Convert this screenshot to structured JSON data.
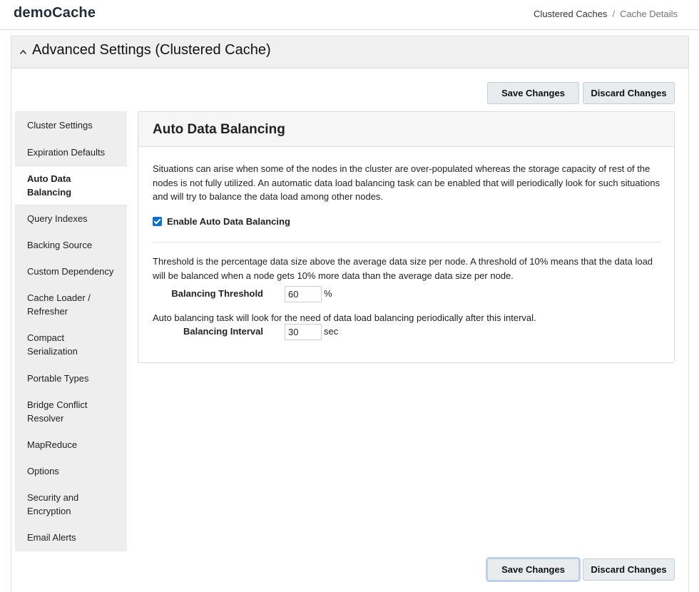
{
  "app": {
    "title": "demoCache"
  },
  "breadcrumb": {
    "items": [
      "Clustered Caches",
      "Cache Details"
    ],
    "separator": "/"
  },
  "panel": {
    "title": "Advanced Settings (Clustered Cache)",
    "collapse_icon": "chevron-up-icon"
  },
  "actions": {
    "save_label": "Save Changes",
    "discard_label": "Discard Changes"
  },
  "sidebar": {
    "active_index": 2,
    "items": [
      {
        "label": "Cluster Settings"
      },
      {
        "label": "Expiration Defaults"
      },
      {
        "label": "Auto Data Balancing"
      },
      {
        "label": "Query Indexes"
      },
      {
        "label": "Backing Source"
      },
      {
        "label": "Custom Dependency"
      },
      {
        "label": "Cache Loader / Refresher"
      },
      {
        "label": "Compact Serialization"
      },
      {
        "label": "Portable Types"
      },
      {
        "label": "Bridge Conflict Resolver"
      },
      {
        "label": "MapReduce"
      },
      {
        "label": "Options"
      },
      {
        "label": "Security and Encryption"
      },
      {
        "label": "Email Alerts"
      }
    ]
  },
  "content": {
    "title": "Auto Data Balancing",
    "description": "Situations can arise when some of the nodes in the cluster are over-populated whereas the storage capacity of rest of the nodes is not fully utilized. An automatic data load balancing task can be enabled that will periodically look for such situations and will try to balance the data load among other nodes.",
    "enable_label": "Enable Auto Data Balancing",
    "enable_checked": true,
    "threshold_description": "Threshold is the percentage data size above the average data size per node. A threshold of 10% means that the data load will be balanced when a node gets 10% more data than the average data size per node.",
    "threshold_label": "Balancing Threshold",
    "threshold_value": "60",
    "threshold_unit": "%",
    "interval_description": "Auto balancing task will look for the need of data load balancing periodically after this interval.",
    "interval_label": "Balancing Interval",
    "interval_value": "30",
    "interval_unit": "sec"
  },
  "colors": {
    "accent": "#0b6fd6",
    "sidebar_bg": "#eeeeee",
    "button_bg": "#e9ecef"
  }
}
